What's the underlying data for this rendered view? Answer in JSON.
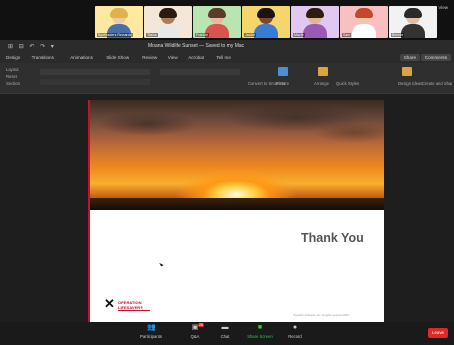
{
  "gallery": {
    "view_label": "View",
    "participants": [
      {
        "name": "Bytetraders Rewards",
        "bg": "#ffe9a0",
        "hair": "#e0b24a",
        "skin": "#f2c9a6",
        "shirt": "#4a6fa8"
      },
      {
        "name": "Tasha",
        "bg": "#f4e6d8",
        "hair": "#2b1a12",
        "skin": "#b07a55",
        "shirt": "#e8e8e8"
      },
      {
        "name": "Frankie",
        "bg": "#b9e6b0",
        "hair": "#5b3b2a",
        "skin": "#e7b89a",
        "shirt": "#d9534f"
      },
      {
        "name": "Jackie",
        "bg": "#f6d66a",
        "hair": "#1d120c",
        "skin": "#7a4a2e",
        "shirt": "#3a7bd5"
      },
      {
        "name": "Macie",
        "bg": "#e0c8f0",
        "hair": "#2e1c12",
        "skin": "#e4b394",
        "shirt": "#9b59b6"
      },
      {
        "name": "Sam",
        "bg": "#f8c0c0",
        "hair": "#c4472e",
        "skin": "#f0c8a8",
        "shirt": "#ffffff"
      },
      {
        "name": "Bennie",
        "bg": "#f2f2f2",
        "hair": "#2a2a2a",
        "skin": "#e5bd9f",
        "shirt": "#333333"
      }
    ]
  },
  "ppt": {
    "title": "Moana Wildlife Sunset — Saved to my Mac",
    "qat": "⊞ ⊟ ↶ ↷ ▾",
    "tabs": [
      "Design",
      "Transitions",
      "Animations",
      "Slide Show",
      "Review",
      "View",
      "Acrobat",
      "Tell me"
    ],
    "share_label": "Share",
    "comments_label": "Comments",
    "ribbon": {
      "layout_label": "Layout",
      "reset_label": "Reset",
      "section_label": "Section",
      "convert_label": "Convert to SmartArt",
      "picture_label": "Picture",
      "arrange_label": "Arrange",
      "styles_label": "Quick Styles",
      "design_label": "Design Ideas",
      "acrobat_label": "Create and Share Adobe PDF"
    }
  },
  "slide": {
    "heading": "Thank You",
    "logo_mark": "✕",
    "logo_line1": "OPERATION",
    "logo_line2": "LIFESAVER®",
    "footnote": "Operation Lifesaver, Inc. all rights reserved 2023"
  },
  "controls": {
    "participants_label": "Participants",
    "participants_count": "14",
    "qa_label": "Q&A",
    "qa_badge": "26",
    "chat_label": "Chat",
    "share_label": "Share Screen",
    "record_label": "Record",
    "end_label": "Leave"
  }
}
